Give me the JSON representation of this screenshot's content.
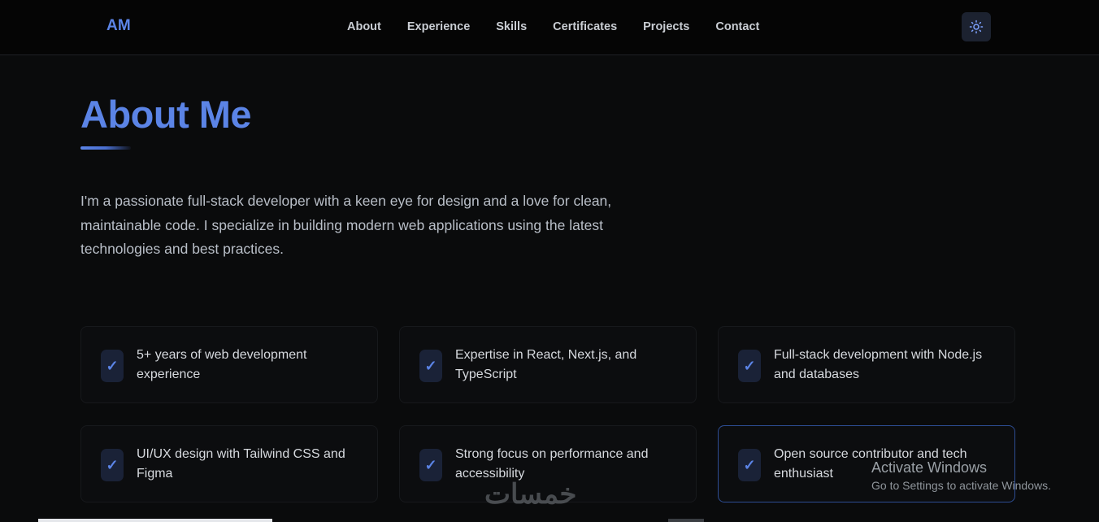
{
  "nav": {
    "logo": "AM",
    "links": [
      "About",
      "Experience",
      "Skills",
      "Certificates",
      "Projects",
      "Contact"
    ],
    "theme_icon": "sun-icon"
  },
  "about": {
    "title": "About Me",
    "bio": "I'm a passionate full-stack developer with a keen eye for design and a love for clean, maintainable code. I specialize in building modern web applications using the latest technologies and best practices.",
    "check_glyph": "✓",
    "cards": [
      "5+ years of web development experience",
      "Expertise in React, Next.js, and TypeScript",
      "Full-stack development with Node.js and databases",
      "UI/UX design with Tailwind CSS and Figma",
      "Strong focus on performance and accessibility",
      "Open source contributor and tech enthusiast"
    ]
  },
  "overlay": {
    "activate_title": "Activate Windows",
    "activate_sub": "Go to Settings to activate Windows.",
    "brand": "خمسات"
  },
  "colors": {
    "accent": "#5b84e6",
    "background": "#0a0b0c",
    "card_border_active": "#2d4d93"
  }
}
